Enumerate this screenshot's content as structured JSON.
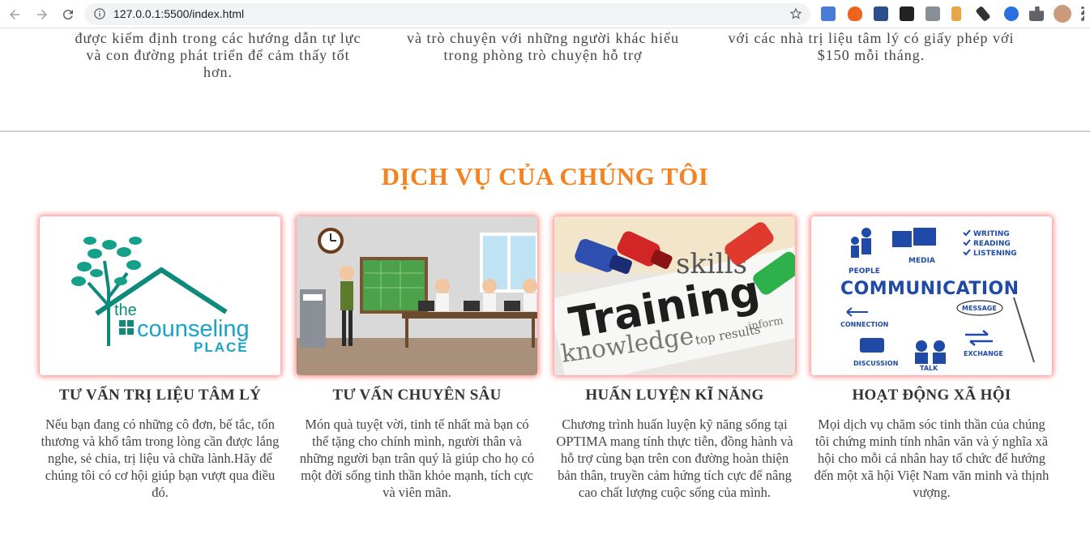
{
  "browser": {
    "url": "127.0.0.1:5500/index.html"
  },
  "top_features": [
    {
      "text": "được kiểm định trong các hướng dẫn tự lực và con đường phát triển để cảm thấy tốt hơn."
    },
    {
      "text": "và trò chuyện với những người khác hiểu trong phòng trò chuyện hỗ trợ"
    },
    {
      "text": "với các nhà trị liệu tâm lý có giấy phép với $150 mỗi tháng."
    }
  ],
  "services": {
    "title": "DỊCH VỤ CỦA CHÚNG TÔI",
    "accent_color": "#f58220",
    "items": [
      {
        "title": "TƯ VẤN TRỊ LIỆU TÂM LÝ",
        "description": "Nếu bạn đang có những cô đơn, bế tắc, tổn thương và khổ tâm trong lòng cần được lắng nghe, sẻ chia, trị liệu và chữa lành.Hãy để chúng tôi có cơ hội giúp bạn vượt qua điều đó.",
        "image_logo_the": "the",
        "image_logo_word": "counseling",
        "image_logo_place": "PLACE"
      },
      {
        "title": "TƯ VẤN CHUYÊN SÂU",
        "description": "Món quà tuyệt vời, tinh tế nhất mà bạn có thể tặng cho chính mình, người thân và những người bạn trân quý là giúp cho họ có một đời sống tinh thần khỏe mạnh, tích cực và viên mãn."
      },
      {
        "title": "HUẤN LUYỆN KĨ NĂNG",
        "description": "Chương trình huấn luyện kỹ năng sống tại OPTIMA mang tính thực tiễn, đồng hành và hỗ trợ cùng bạn trên con đường hoàn thiện bản thân, truyền cảm hứng tích cực để nâng cao chất lượng cuộc sống của mình.",
        "image_word": "Training",
        "image_small_words": [
          "skills",
          "knowledge",
          "top results",
          "inform"
        ]
      },
      {
        "title": "HOẠT ĐỘNG XÃ HỘI",
        "description": "Mọi dịch vụ chăm sóc tinh thần của chúng tôi chứng minh tính nhân văn và ý nghĩa xã hội cho mỗi cá nhân hay tổ chức để hướng đến một xã hội Việt Nam văn minh và thịnh vượng.",
        "image_word": "COMMUNICATION",
        "image_labels": [
          "PEOPLE",
          "MEDIA",
          "WRITING",
          "READING",
          "LISTENING",
          "CONNECTION",
          "MESSAGE",
          "DISCUSSION",
          "TALK",
          "EXCHANGE"
        ]
      }
    ]
  }
}
